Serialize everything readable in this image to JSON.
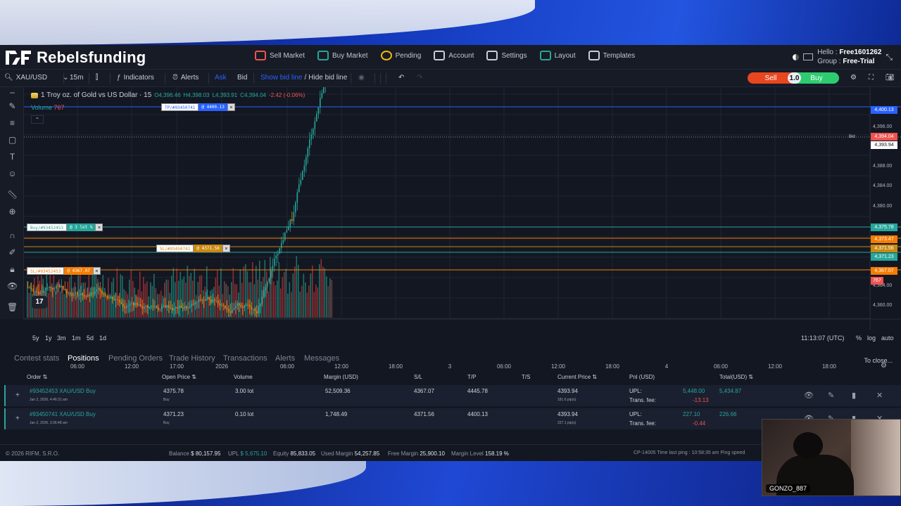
{
  "brand": {
    "name": "Rebelsfunding"
  },
  "nav": [
    {
      "label": "Sell Market",
      "icon": "sell-market-icon",
      "color": "#ef5350"
    },
    {
      "label": "Buy Market",
      "icon": "buy-market-icon",
      "color": "#26a69a"
    },
    {
      "label": "Pending",
      "icon": "pending-icon",
      "color": "#f0b90b"
    },
    {
      "label": "Account",
      "icon": "account-icon",
      "color": "#c9cdd6"
    },
    {
      "label": "Settings",
      "icon": "settings-icon",
      "color": "#c9cdd6"
    },
    {
      "label": "Layout",
      "icon": "layout-icon",
      "color": "#26a69a"
    },
    {
      "label": "Templates",
      "icon": "templates-icon",
      "color": "#c9cdd6"
    }
  ],
  "user": {
    "hello_prefix": "Hello :",
    "name": "Free1601262",
    "group_prefix": "Group :",
    "group": "Free-Trial"
  },
  "toolbar": {
    "symbol": "XAU/USD",
    "interval": "15m",
    "indicators": "Indicators",
    "alerts": "Alerts",
    "ask": "Ask",
    "bid": "Bid",
    "show_bid": "Show bid line",
    "slash": "/",
    "hide_bid": "Hide bid line",
    "sell": "Sell",
    "qty": "1.0",
    "buy": "Buy"
  },
  "chart": {
    "legend_title": "1 Troy oz. of Gold vs US Dollar · 15",
    "o": "O4,396.46",
    "h": "H4,398.03",
    "l": "L4,393.91",
    "c": "C4,394.04",
    "chg": "-2.42 (-0.06%)",
    "volume_label": "Volume",
    "volume_value": "767",
    "bid_label": "Bid",
    "clock": "11:13:07 (UTC)",
    "pct": "%",
    "log": "log",
    "auto": "auto",
    "ranges": [
      "5y",
      "1y",
      "3m",
      "1m",
      "5d",
      "1d"
    ],
    "price_axis": [
      "4,396.00",
      "4,388.00",
      "4,384.00",
      "4,380.00",
      "4,364.00",
      "4,360.00"
    ],
    "time_axis": [
      "06:00",
      "12:00",
      "17:00",
      "2026",
      "06:00",
      "12:00",
      "18:00",
      "3",
      "06:00",
      "12:00",
      "18:00",
      "4",
      "06:00",
      "12:00",
      "18:00"
    ],
    "price_tags": [
      {
        "text": "4,400.13",
        "color": "#2962ff"
      },
      {
        "text": "4,394.04",
        "color": "#ef5350"
      },
      {
        "text": "4,393.94",
        "color": "#ffffff"
      },
      {
        "text": "4,375.78",
        "color": "#26a69a"
      },
      {
        "text": "4,373.47",
        "color": "#f57c00"
      },
      {
        "text": "4,371.56",
        "color": "#c98a12"
      },
      {
        "text": "4,371.23",
        "color": "#26a69a"
      },
      {
        "text": "4,367.07",
        "color": "#f57c00"
      },
      {
        "text": "767",
        "color": "#ef5350"
      }
    ],
    "order_tags": {
      "tp": {
        "label": "TP/#93450741",
        "value": "@ 4400.13"
      },
      "buy": {
        "label": "Buy/#93452453",
        "value": "@ 3 lot %"
      },
      "sl1": {
        "label": "SL/#93450741",
        "value": "@ 4371.56"
      },
      "sl2": {
        "label": "SL/#93452453",
        "value": "@ 4367.07"
      }
    },
    "colors": {
      "up": "#26a69a",
      "down": "#ef5350",
      "tp": "#2962ff",
      "sl": "#f57c00"
    }
  },
  "chart_data": {
    "type": "candlestick",
    "symbol": "XAU/USD",
    "interval": "15m",
    "last_price": 4394.04,
    "price_axis": [
      4360,
      4364,
      4380,
      4384,
      4388,
      4396
    ],
    "price_range": [
      4358,
      4402
    ],
    "levels": {
      "tp": 4400.13,
      "bid": 4393.94,
      "buy_open": 4375.78,
      "sl_1": 4371.56,
      "open_2": 4371.23,
      "sl_2": 4367.07
    },
    "volume_last": 767
  },
  "tabs": [
    "Contest stats",
    "Positions",
    "Pending Orders",
    "Trade History",
    "Transactions",
    "Alerts",
    "Messages"
  ],
  "active_tab": "Positions",
  "to_close": "To close...",
  "columns": [
    "Order",
    "Open Price",
    "Volume",
    "Margin (USD)",
    "S/L",
    "T/P",
    "T/S",
    "Current Price",
    "Pnl (USD)",
    "Total(USD)"
  ],
  "positions": [
    {
      "order": "#93452453 XAU/USD Buy",
      "date": "Jan 2, 2026, 4:46:31 am",
      "open": "4375.78",
      "side": "Buy",
      "volume": "3.00 lot",
      "margin": "52,509.36",
      "sl": "4367.07",
      "tp": "4445.78",
      "ts": "",
      "current": "4393.94",
      "pips": "181.6 pip(s)",
      "upl_label": "UPL:",
      "upl": "5,448.00",
      "fee_label": "Trans. fee:",
      "fee": "-13.13",
      "total": "5,434.87"
    },
    {
      "order": "#93450741 XAU/USD Buy",
      "date": "Jan 2, 2026, 3:36:48 am",
      "open": "4371.23",
      "side": "Buy",
      "volume": "0.10 lot",
      "margin": "1,748.49",
      "sl": "4371.56",
      "tp": "4400.13",
      "ts": "",
      "current": "4393.94",
      "pips": "227.1 pip(s)",
      "upl_label": "UPL:",
      "upl": "227.10",
      "fee_label": "Trans. fee:",
      "fee": "-0.44",
      "total": "226.66"
    }
  ],
  "footer": {
    "copyright": "© 2026 RIFM, S.R.O.",
    "balance_label": "Balance",
    "balance": "$ 80,157.95",
    "upl_label": "UPL",
    "upl": "$ 5,675.10",
    "equity_label": "Equity",
    "equity": "85,833.05",
    "used_label": "Used Margin",
    "used": "54,257.85",
    "free_label": "Free Margin",
    "free": "25,900.10",
    "level_label": "Margin Level",
    "level": "158.19 %",
    "ping": "CP-14005 Time last ping : 10:58:35 am   Ping speed"
  },
  "webcam": {
    "name": "GONZO_887"
  }
}
